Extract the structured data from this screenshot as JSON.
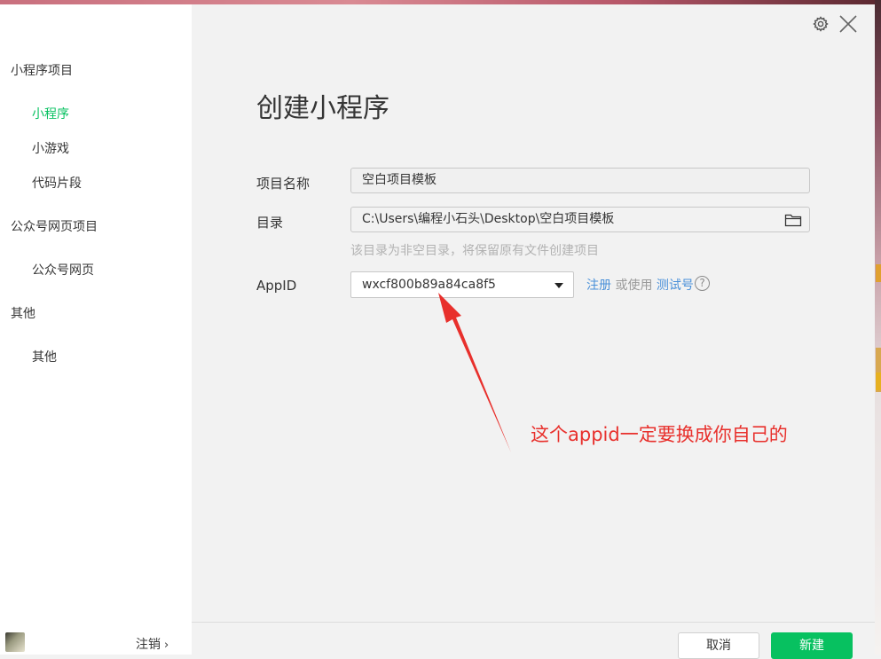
{
  "sidebar": {
    "sections": [
      {
        "title": "小程序项目",
        "items": [
          "小程序",
          "小游戏",
          "代码片段"
        ]
      },
      {
        "title": "公众号网页项目",
        "items": [
          "公众号网页"
        ]
      },
      {
        "title": "其他",
        "items": [
          "其他"
        ]
      }
    ],
    "logout_label": "注销",
    "logout_chevron": "›"
  },
  "main": {
    "title": "创建小程序",
    "project_name_label": "项目名称",
    "project_name_value": "空白项目模板",
    "directory_label": "目录",
    "directory_value": "C:\\Users\\编程小石头\\Desktop\\空白项目模板",
    "directory_hint": "该目录为非空目录，将保留原有文件创建项目",
    "appid_label": "AppID",
    "appid_value": "wxcf800b89a84ca8f5",
    "register_link": "注册",
    "or_use_text": " 或使用 ",
    "test_account_link": "测试号",
    "help_glyph": "?"
  },
  "annotation": {
    "text": "这个appid一定要换成你自己的",
    "color": "#e8302c"
  },
  "footer": {
    "cancel_label": "取消",
    "create_label": "新建"
  },
  "colors": {
    "accent": "#07c160",
    "link": "#4a90d9"
  }
}
